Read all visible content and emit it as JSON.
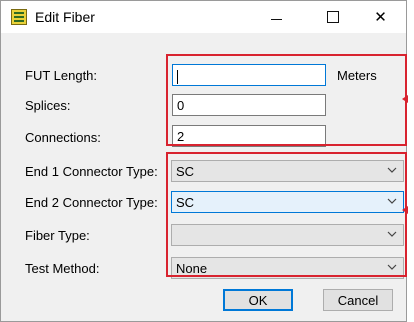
{
  "window": {
    "title": "Edit Fiber",
    "icon": "fiber-app-icon",
    "controls": [
      "minimize-icon",
      "maximize-icon",
      "close-icon"
    ],
    "close_glyph": "✕"
  },
  "form": {
    "fut_length": {
      "label": "FUT Length:",
      "value": "",
      "unit": "Meters"
    },
    "splices": {
      "label": "Splices:",
      "value": "0"
    },
    "connections": {
      "label": "Connections:",
      "value": "2"
    },
    "end1_connector": {
      "label": "End 1 Connector Type:",
      "value": "SC"
    },
    "end2_connector": {
      "label": "End 2 Connector Type:",
      "value": "SC"
    },
    "fiber_type": {
      "label": "Fiber Type:",
      "value": ""
    },
    "test_method": {
      "label": "Test Method:",
      "value": "None"
    }
  },
  "buttons": {
    "ok": "OK",
    "cancel": "Cancel"
  },
  "colors": {
    "highlight": "#d8232f",
    "focus": "#0078d7",
    "app_icon": "#e9d23a"
  }
}
